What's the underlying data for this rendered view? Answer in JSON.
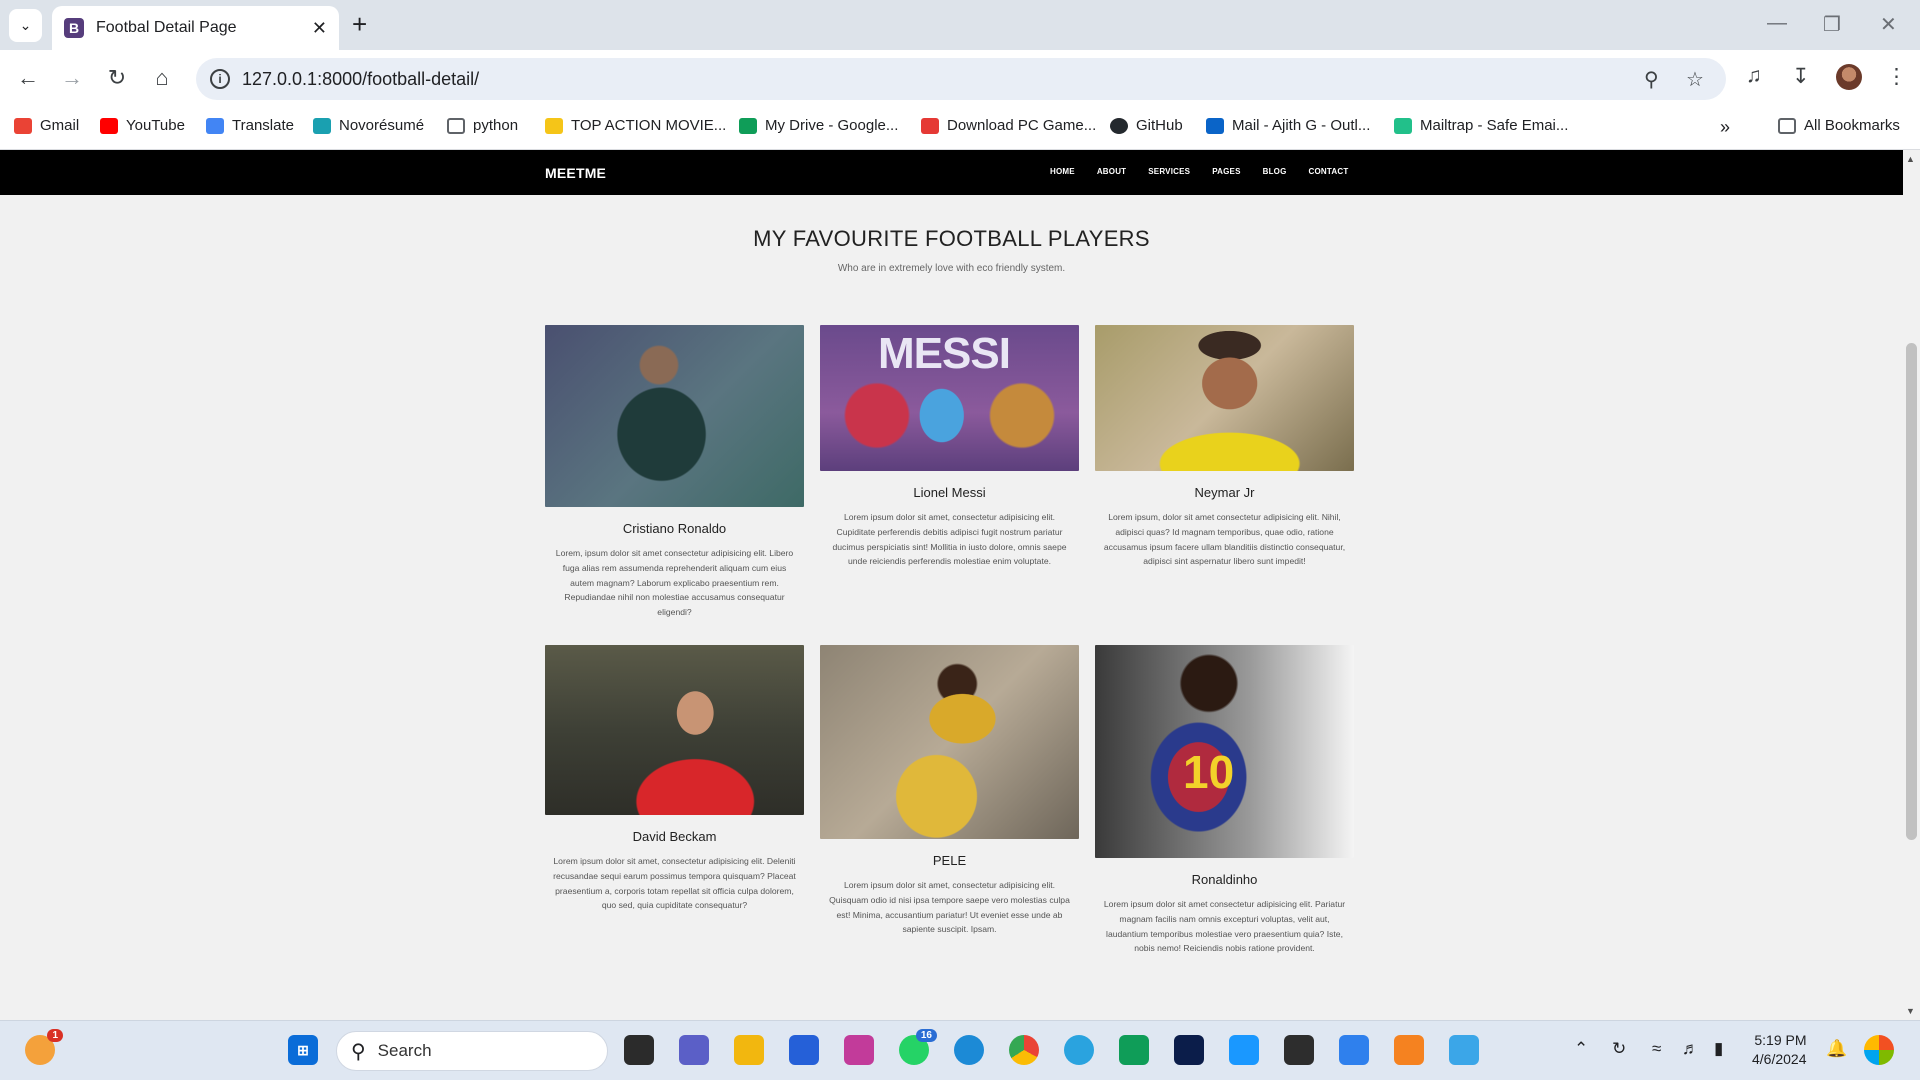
{
  "browser": {
    "tab_title": "Footbal Detail Page",
    "tab_favicon_letter": "B",
    "url": "127.0.0.1:8000/football-detail/",
    "bookmarks": [
      {
        "label": "Gmail",
        "color": "#ea4335"
      },
      {
        "label": "YouTube",
        "color": "#ff0000"
      },
      {
        "label": "Translate",
        "color": "#4285f4"
      },
      {
        "label": "Novorésumé",
        "color": "#1aa0b0"
      },
      {
        "label": "python",
        "color": "#5f6368"
      },
      {
        "label": "TOP ACTION MOVIE...",
        "color": "#f5c518"
      },
      {
        "label": "My Drive - Google...",
        "color": "#0f9d58"
      },
      {
        "label": "Download PC Game...",
        "color": "#e53935"
      },
      {
        "label": "GitHub",
        "color": "#24292e"
      },
      {
        "label": "Mail - Ajith G - Outl...",
        "color": "#0a64c8"
      },
      {
        "label": "Mailtrap - Safe Emai...",
        "color": "#22c08a"
      }
    ],
    "all_bookmarks": "All Bookmarks"
  },
  "site": {
    "brand": "MEETME",
    "nav": [
      "HOME",
      "ABOUT",
      "SERVICES",
      "PAGES",
      "BLOG",
      "CONTACT"
    ],
    "title": "MY FAVOURITE FOOTBALL PLAYERS",
    "subtitle": "Who are in extremely love with eco friendly system.",
    "players": [
      {
        "name": "Cristiano Ronaldo",
        "desc": "Lorem, ipsum dolor sit amet consectetur adipisicing elit. Libero fuga alias rem assumenda reprehenderit aliquam cum eius autem magnam? Laborum explicabo praesentium rem. Repudiandae nihil non molestiae accusamus consequatur eligendi?"
      },
      {
        "name": "Lionel Messi",
        "image_text": "MESSI",
        "desc": "Lorem ipsum dolor sit amet, consectetur adipisicing elit. Cupiditate perferendis debitis adipisci fugit nostrum pariatur ducimus perspiciatis sint! Mollitia in iusto dolore, omnis saepe unde reiciendis perferendis molestiae enim voluptate."
      },
      {
        "name": "Neymar Jr",
        "desc": "Lorem ipsum, dolor sit amet consectetur adipisicing elit. Nihil, adipisci quas? Id magnam temporibus, quae odio, ratione accusamus ipsum facere ullam blanditiis distinctio consequatur, adipisci sint aspernatur libero sunt impedit!"
      },
      {
        "name": "David Beckam",
        "desc": "Lorem ipsum dolor sit amet, consectetur adipisicing elit. Deleniti recusandae sequi earum possimus tempora quisquam? Placeat praesentium a, corporis totam repellat sit officia culpa dolorem, quo sed, quia cupiditate consequatur?"
      },
      {
        "name": "PELE",
        "desc": "Lorem ipsum dolor sit amet, consectetur adipisicing elit. Quisquam odio id nisi ipsa tempore saepe vero molestias culpa est! Minima, accusantium pariatur! Ut eveniet esse unde ab sapiente suscipit. Ipsam."
      },
      {
        "name": "Ronaldinho",
        "image_text": "10",
        "desc": "Lorem ipsum dolor sit amet consectetur adipisicing elit. Pariatur magnam facilis nam omnis excepturi voluptas, velit aut, laudantium temporibus molestiae vero praesentium quia? Iste, nobis nemo! Reiciendis nobis ratione provident."
      }
    ]
  },
  "taskbar": {
    "search_placeholder": "Search",
    "whatsapp_badge": "16",
    "notification_badge": "1",
    "time": "5:19 PM",
    "date": "4/6/2024"
  }
}
